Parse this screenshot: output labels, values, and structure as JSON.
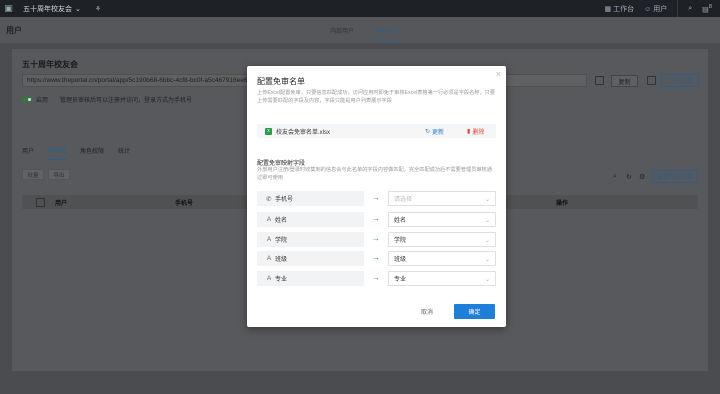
{
  "topbar": {
    "org_name": "五十周年校友会",
    "workbench": "工作台",
    "user": "用户",
    "badge": "8"
  },
  "subheader": {
    "title": "用户",
    "tabs": [
      "内部用户",
      "外部门户"
    ]
  },
  "card": {
    "title": "五十周年校友会",
    "url": "https://www.theportal.cn/portal/app/5c190b68-6bbc-4cf8-bc0f-a5c467916ee6",
    "copy_label": "复制",
    "portal_settings": "门户设置",
    "toggle_label": "启用",
    "toggle_desc": "管理员审核后可以注册并访问，登录方式为手机号",
    "tabs": [
      "用户",
      "待审核",
      "角色权限",
      "统计"
    ],
    "toolbar": [
      "批量",
      "导出"
    ],
    "config_button": "配置免审名单",
    "columns": [
      "用户",
      "手机号",
      "操作"
    ]
  },
  "modal": {
    "title": "配置免审名单",
    "description": "上传Excel配置免审，只要信息匹配成功，访问应用时即免于审核Excel表格第一行必须是字段名称，只要上传需要匹配的字段及内容，字段只能是用户列表展示字段",
    "file": {
      "name": "校友会免审名单.xlsx",
      "update": "更新",
      "delete": "删除"
    },
    "mapping_title": "配置免审映射字段",
    "mapping_desc": "外部用户注册/登录时收集到的信息会与此名单的字段内容做匹配，完全匹配成功后不需要管理员审核通过即可使用",
    "rows": [
      {
        "left": "手机号",
        "icon": "phone-icon",
        "right": "请选择",
        "placeholder": true
      },
      {
        "left": "姓名",
        "icon": "text-icon",
        "right": "姓名",
        "placeholder": false
      },
      {
        "left": "学院",
        "icon": "text-icon",
        "right": "学院",
        "placeholder": false
      },
      {
        "left": "班级",
        "icon": "text-icon",
        "right": "班级",
        "placeholder": false
      },
      {
        "left": "专业",
        "icon": "text-icon",
        "right": "专业",
        "placeholder": false
      }
    ],
    "cancel": "取消",
    "confirm": "确定"
  },
  "colors": {
    "primary": "#1f7ed8",
    "danger": "#e2453a",
    "excel": "#2e9b46"
  }
}
